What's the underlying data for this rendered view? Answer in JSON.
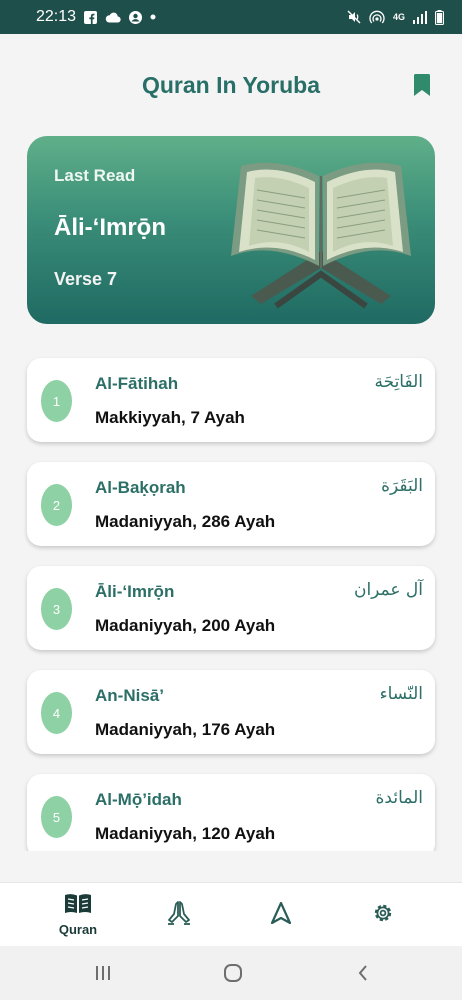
{
  "status_bar": {
    "time": "22:13",
    "left_icons": [
      "facebook-icon",
      "cloud-icon",
      "account-icon",
      "dot-icon"
    ],
    "right_icons": [
      "mute-icon",
      "hotspot-icon",
      "4g-icon",
      "signal-icon",
      "battery-icon"
    ],
    "network": "4G"
  },
  "header": {
    "title": "Quran In Yoruba",
    "bookmark_icon": "bookmark-icon"
  },
  "last_read": {
    "label": "Last Read",
    "surah": "Āli-‘Imrọ̄n",
    "verse": "Verse 7"
  },
  "surahs": [
    {
      "number": "1",
      "name": "Al-Fātihah",
      "arabic": "الفَاتِحَة",
      "meta": "Makkiyyah, 7 Ayah"
    },
    {
      "number": "2",
      "name": "Al-Baḳọrah",
      "arabic": "البَقَرَة",
      "meta": "Madaniyyah, 286 Ayah"
    },
    {
      "number": "3",
      "name": "Āli-‘Imrọ̄n",
      "arabic": "آل عمران",
      "meta": "Madaniyyah, 200 Ayah"
    },
    {
      "number": "4",
      "name": "An-Nisā’",
      "arabic": "النّساء",
      "meta": "Madaniyyah, 176 Ayah"
    },
    {
      "number": "5",
      "name": "Al-Mọ̄’idah",
      "arabic": "المائدة",
      "meta": "Madaniyyah, 120 Ayah"
    }
  ],
  "bottom_nav": {
    "items": [
      {
        "icon": "quran-book-icon",
        "label": "Quran"
      },
      {
        "icon": "prayer-hands-icon",
        "label": ""
      },
      {
        "icon": "qibla-arrow-icon",
        "label": ""
      },
      {
        "icon": "settings-gear-icon",
        "label": ""
      }
    ]
  },
  "system_nav": [
    "recents-icon",
    "home-icon",
    "back-icon"
  ],
  "colors": {
    "primary": "#276f67",
    "badge": "#8dd1a4",
    "card_gradient_top": "#5faf89",
    "card_gradient_bottom": "#1f6a63",
    "status_bar": "#1f4f4a"
  }
}
